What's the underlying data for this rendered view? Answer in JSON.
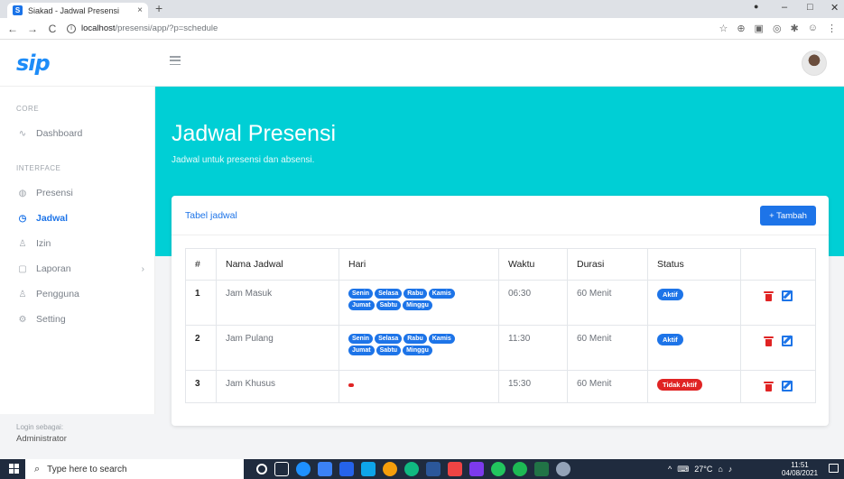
{
  "browser": {
    "tab_title": "Siakad - Jadwal Presensi",
    "favicon_letter": "S",
    "tab_close": "×",
    "new_tab": "+",
    "url_host": "localhost",
    "url_path": "/presensi/app/?p=schedule",
    "back": "←",
    "forward": "→",
    "reload": "C",
    "star": "☆",
    "info_icon": "i",
    "win_min": "–",
    "win_max": "□",
    "win_close": "✕"
  },
  "app": {
    "logo": "sip"
  },
  "sidebar": {
    "core_heading": "CORE",
    "interface_heading": "INTERFACE",
    "items": [
      {
        "label": "Dashboard",
        "icon": "activity-icon"
      },
      {
        "label": "Presensi",
        "icon": "fingerprint-icon"
      },
      {
        "label": "Jadwal",
        "icon": "clock-icon"
      },
      {
        "label": "Izin",
        "icon": "user-icon"
      },
      {
        "label": "Laporan",
        "icon": "file-icon",
        "chevron": "›"
      },
      {
        "label": "Pengguna",
        "icon": "users-icon"
      },
      {
        "label": "Setting",
        "icon": "settings-icon"
      }
    ],
    "footer_label": "Login sebagai:",
    "footer_user": "Administrator"
  },
  "hero": {
    "title": "Jadwal Presensi",
    "subtitle": "Jadwal untuk presensi dan absensi."
  },
  "card": {
    "title": "Tabel jadwal",
    "add_button": "+ Tambah"
  },
  "table": {
    "headers": [
      "#",
      "Nama Jadwal",
      "Hari",
      "Waktu",
      "Durasi",
      "Status",
      ""
    ],
    "rows": [
      {
        "no": "1",
        "name": "Jam Masuk",
        "days": [
          "Senin",
          "Selasa",
          "Rabu",
          "Kamis",
          "Jumat",
          "Sabtu",
          "Minggu"
        ],
        "time": "06:30",
        "duration": "60 Menit",
        "status": "Aktif"
      },
      {
        "no": "2",
        "name": "Jam Pulang",
        "days": [
          "Senin",
          "Selasa",
          "Rabu",
          "Kamis",
          "Jumat",
          "Sabtu",
          "Minggu"
        ],
        "time": "11:30",
        "duration": "60 Menit",
        "status": "Aktif"
      },
      {
        "no": "3",
        "name": "Jam Khusus",
        "days": [],
        "time": "15:30",
        "duration": "60 Menit",
        "status": "Tidak Aktif"
      }
    ]
  },
  "taskbar": {
    "search_placeholder": "Type here to search",
    "temperature": "27°C",
    "time": "11:51",
    "date": "04/08/2021",
    "tray_arrow": "^"
  },
  "colors": {
    "accent": "#1d74e8",
    "hero": "#00cfd5",
    "danger": "#e02424"
  }
}
